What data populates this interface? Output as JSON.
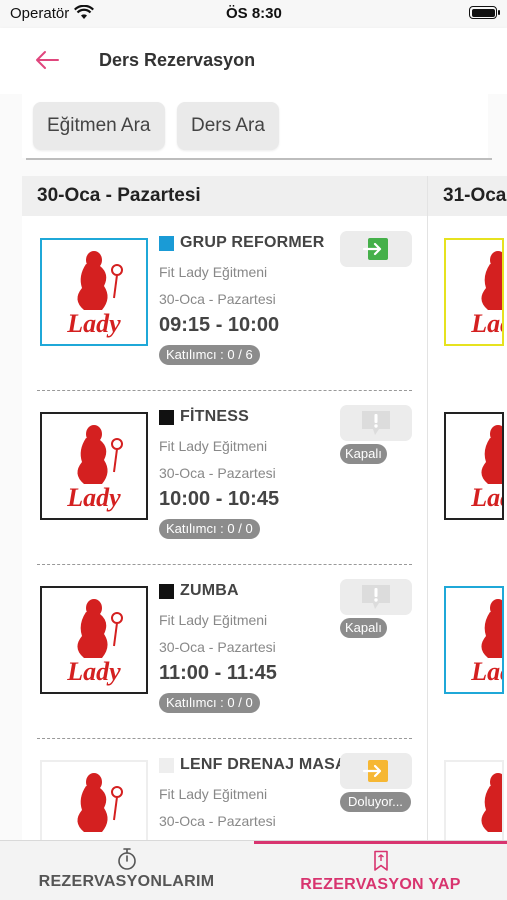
{
  "status_bar": {
    "carrier": "Operatör",
    "time": "ÖS 8:30"
  },
  "header": {
    "title": "Ders Rezervasyon",
    "back_icon": "arrow-left-icon",
    "accent": "#e0467d"
  },
  "filters": {
    "trainer_search": "Eğitmen Ara",
    "class_search": "Ders Ara"
  },
  "days": [
    {
      "label": "30-Oca - Pazartesi",
      "classes": [
        {
          "name": "GRUP REFORMER",
          "color": "#1a9bd6",
          "trainer": "Fit Lady Eğitmeni",
          "date": "30-Oca - Pazartesi",
          "time": "09:15 - 10:00",
          "participants": "Katılımcı : 0 / 6",
          "action_icon": "enter-icon",
          "status": ""
        },
        {
          "name": "FİTNESS",
          "color": "#111111",
          "trainer": "Fit Lady Eğitmeni",
          "date": "30-Oca - Pazartesi",
          "time": "10:00 - 10:45",
          "participants": "Katılımcı : 0 / 0",
          "action_icon": "exclamation-icon",
          "status": "Kapalı"
        },
        {
          "name": "ZUMBA",
          "color": "#111111",
          "trainer": "Fit Lady Eğitmeni",
          "date": "30-Oca - Pazartesi",
          "time": "11:00 - 11:45",
          "participants": "Katılımcı : 0 / 0",
          "action_icon": "exclamation-icon",
          "status": "Kapalı"
        },
        {
          "name": "LENF DRENAJ MASAJI",
          "color": "#eeeeee",
          "trainer": "Fit Lady Eğitmeni",
          "date": "30-Oca - Pazartesi",
          "time": "",
          "participants": "",
          "action_icon": "enter-icon",
          "status": "Doluyor..."
        }
      ]
    },
    {
      "label": "31-Oca"
    }
  ],
  "logo": {
    "text": "Lady",
    "color": "#d42020"
  },
  "tabs": [
    {
      "label": "REZERVASYONLARIM",
      "icon": "stopwatch-icon",
      "color": "#555555"
    },
    {
      "label": "REZERVASYON YAP",
      "icon": "bookmark-icon",
      "color": "#d8346f"
    }
  ]
}
